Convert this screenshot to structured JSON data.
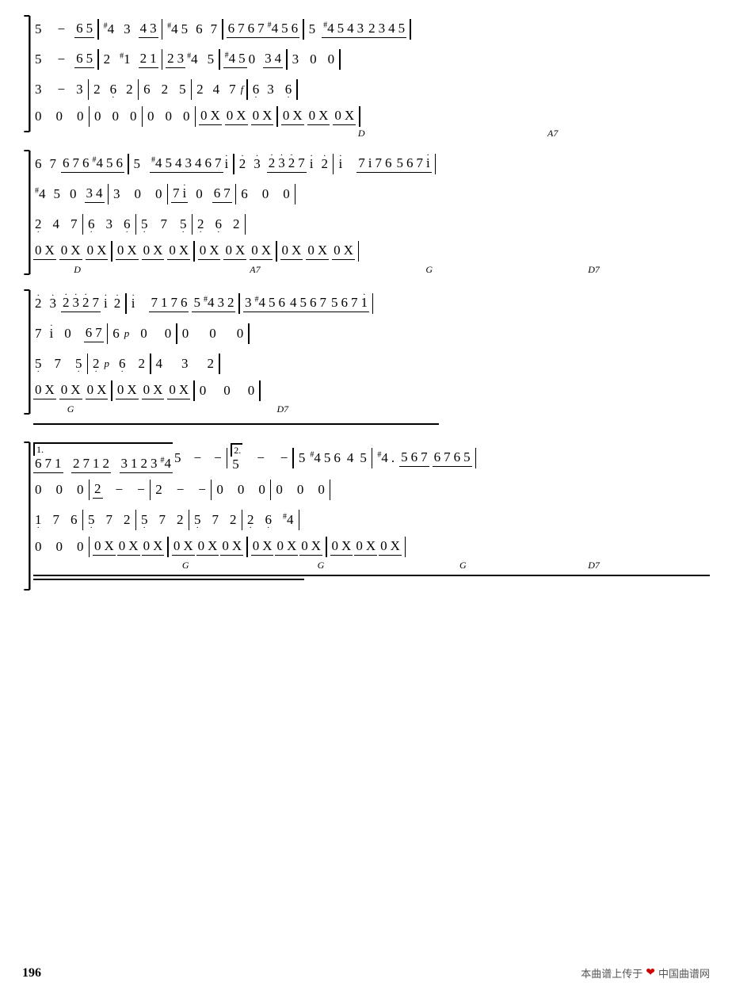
{
  "page": {
    "number": "196",
    "footer": "本曲谱上传于",
    "footer_site": "中国曲谱网",
    "sections": []
  }
}
